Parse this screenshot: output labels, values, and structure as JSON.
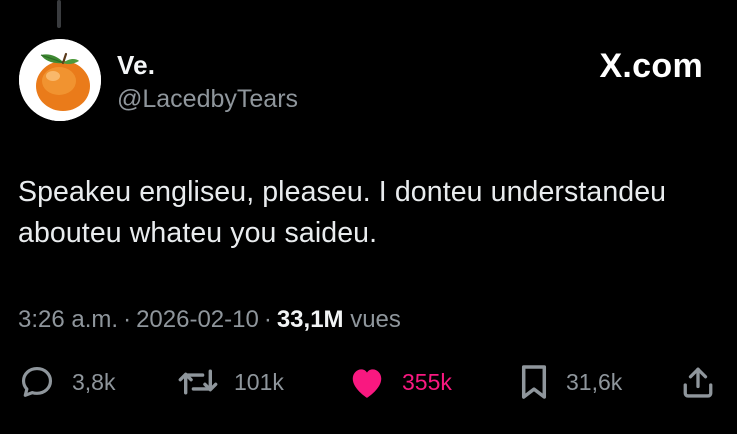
{
  "user": {
    "display_name": "Ve.",
    "handle": "@LacedbyTears",
    "avatar_icon": "tangerine-avatar"
  },
  "brand": {
    "label": "X.com"
  },
  "tweet": {
    "text": "Speakeu engliseu, pleaseu. I donteu understandeu abouteu whateu you saideu."
  },
  "meta": {
    "time": "3:26 a.m.",
    "separator": "·",
    "date": "2026-02-10",
    "views_count": "33,1M",
    "views_label": "vues"
  },
  "actions": {
    "replies": {
      "icon": "reply-icon",
      "count": "3,8k"
    },
    "reposts": {
      "icon": "repost-icon",
      "count": "101k"
    },
    "likes": {
      "icon": "heart-icon",
      "count": "355k",
      "liked": true
    },
    "bookmarks": {
      "icon": "bookmark-icon",
      "count": "31,6k"
    },
    "share": {
      "icon": "share-icon"
    }
  },
  "colors": {
    "background": "#000000",
    "text": "#e7e9ea",
    "secondary": "#8f969c",
    "like": "#f91880"
  }
}
